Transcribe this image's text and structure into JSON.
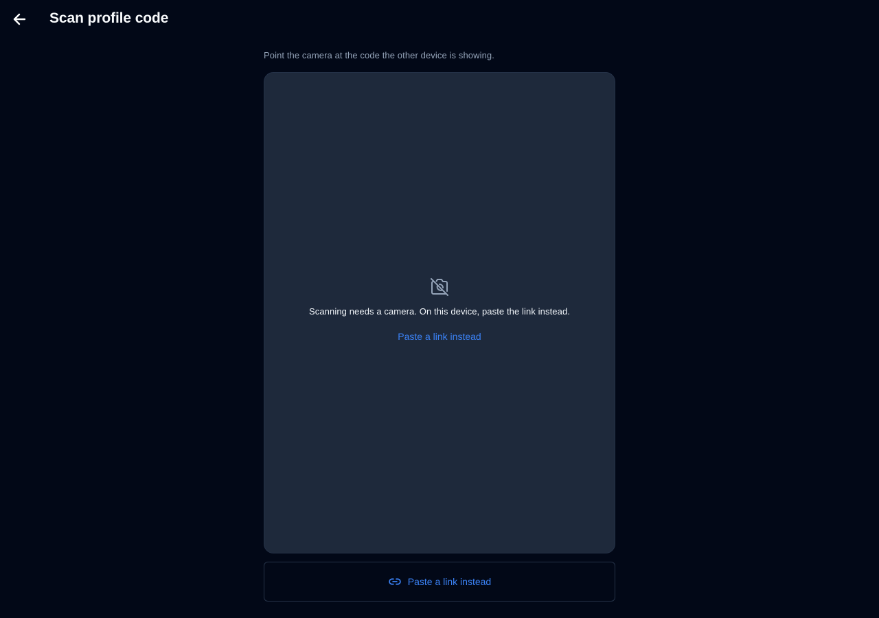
{
  "header": {
    "back_icon": "arrow-left-icon",
    "title": "Scan profile code"
  },
  "main": {
    "instruction": "Point the camera at the code the other device is showing.",
    "scanner": {
      "icon": "camera-off-icon",
      "message": "Scanning needs a camera. On this device, paste the link instead.",
      "link_label": "Paste a link instead"
    },
    "paste_button": {
      "icon": "link-icon",
      "label": "Paste a link instead"
    }
  },
  "colors": {
    "background": "#020817",
    "panel": "#1e293b",
    "accent": "#3b82f6",
    "muted_text": "#94a3b8"
  }
}
